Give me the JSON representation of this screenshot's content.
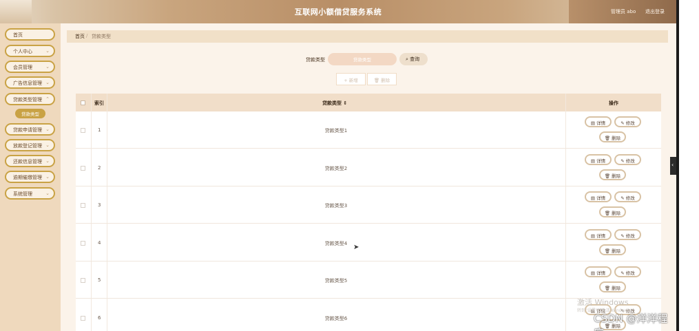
{
  "header": {
    "title": "互联网小额借贷服务系统",
    "user": "管理员 abo",
    "logout": "退出登录"
  },
  "sidebar": {
    "items": [
      {
        "label": "首页",
        "chevron": ""
      },
      {
        "label": "个人中心",
        "chevron": "⌄"
      },
      {
        "label": "会员管理",
        "chevron": "⌄"
      },
      {
        "label": "广告信息管理",
        "chevron": "⌄"
      },
      {
        "label": "贷款类型管理",
        "chevron": "⌃"
      },
      {
        "label": "贷款申请管理",
        "chevron": "⌄"
      },
      {
        "label": "放款登记管理",
        "chevron": "⌄"
      },
      {
        "label": "还款信息管理",
        "chevron": "⌄"
      },
      {
        "label": "逾期催缴管理",
        "chevron": "⌄"
      },
      {
        "label": "系统管理",
        "chevron": "⌄"
      }
    ],
    "active_sub": "贷款类型"
  },
  "breadcrumb": {
    "home": "首页",
    "sep": "/",
    "current": "贷款类型"
  },
  "search": {
    "label": "贷款类型",
    "placeholder": "贷款类型",
    "button": "查询",
    "icon": "search-icon"
  },
  "actions": {
    "add": "+ 新增",
    "delete": "删除"
  },
  "table": {
    "columns": {
      "index": "索引",
      "type": "贷款类型 ⇕",
      "ops": "操作"
    },
    "rows": [
      {
        "index": "1",
        "type": "贷款类型1"
      },
      {
        "index": "2",
        "type": "贷款类型2"
      },
      {
        "index": "3",
        "type": "贷款类型3"
      },
      {
        "index": "4",
        "type": "贷款类型4"
      },
      {
        "index": "5",
        "type": "贷款类型5"
      },
      {
        "index": "6",
        "type": "贷款类型6"
      }
    ],
    "row_ops": {
      "detail": "详情",
      "edit": "修改",
      "delete": "删除"
    }
  },
  "overlay": {
    "activate": "激活 Windows",
    "activate_sub": "转到\"设置\"以激活 Windows。",
    "csdn": "CSDN @洋洋程序"
  },
  "colors": {
    "accent": "#c9a244",
    "header": "#b88e66",
    "sidebar": "#efd9bd",
    "table_head": "#f1dec9"
  }
}
